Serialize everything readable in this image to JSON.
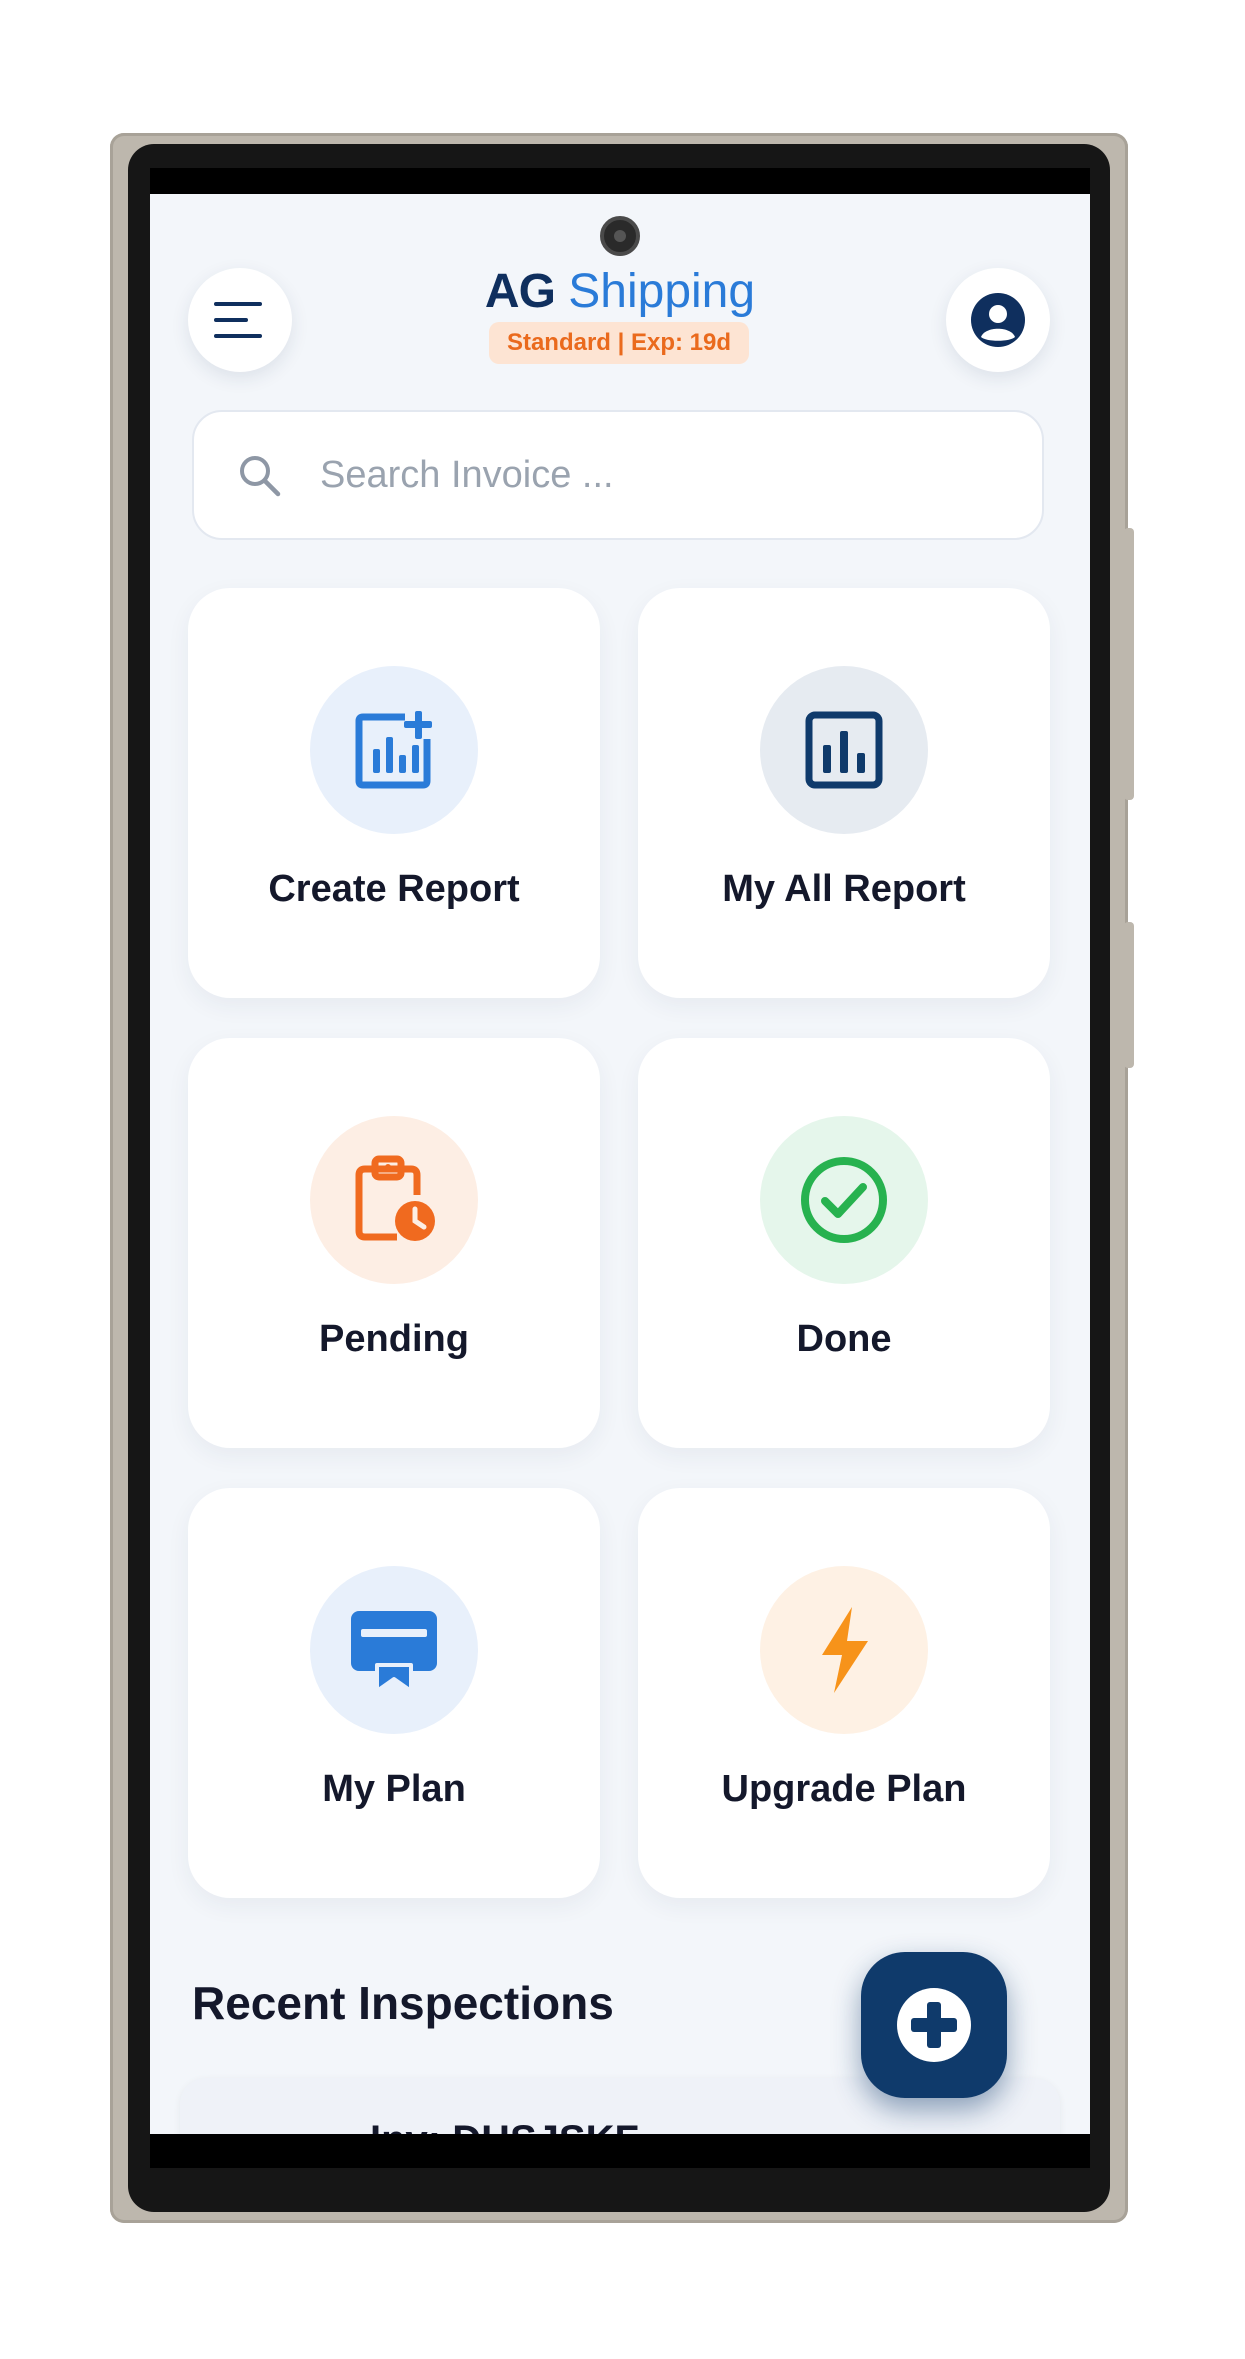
{
  "header": {
    "brand_primary": "AG",
    "brand_secondary": "Shipping",
    "plan_badge": "Standard | Exp: 19d"
  },
  "search": {
    "placeholder": "Search Invoice ..."
  },
  "tiles": [
    {
      "label": "Create Report",
      "icon": "report-add-icon",
      "bg": "#e8f0fb",
      "color": "#2a7bd8"
    },
    {
      "label": "My All Report",
      "icon": "bar-chart-icon",
      "bg": "#e6ebf1",
      "color": "#0f3a6b"
    },
    {
      "label": "Pending",
      "icon": "clipboard-clock-icon",
      "bg": "#fdeee4",
      "color": "#f06a1f"
    },
    {
      "label": "Done",
      "icon": "check-circle-icon",
      "bg": "#e5f6eb",
      "color": "#27b24f"
    },
    {
      "label": "My Plan",
      "icon": "card-ribbon-icon",
      "bg": "#e8f0fb",
      "color": "#2a7bd8"
    },
    {
      "label": "Upgrade Plan",
      "icon": "lightning-icon",
      "bg": "#fef1e4",
      "color": "#f7931a"
    }
  ],
  "recent": {
    "title": "Recent Inspections",
    "items": [
      {
        "invoice": "Inv: DHSJSKF"
      }
    ]
  },
  "colors": {
    "primary": "#0f3a6b",
    "accent": "#2a7bd8",
    "background": "#f3f6fa"
  }
}
